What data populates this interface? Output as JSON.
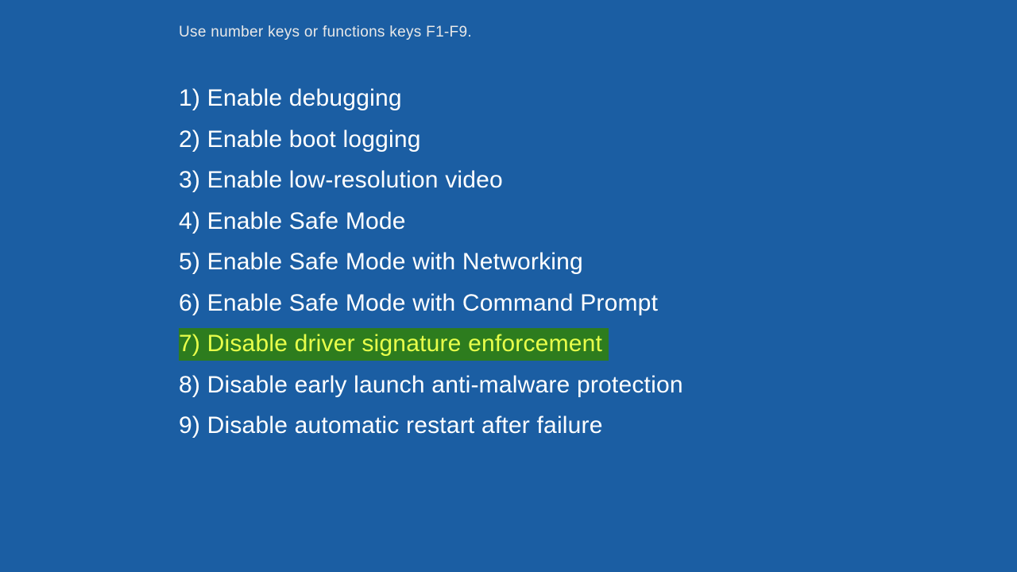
{
  "instruction": "Use number keys or functions keys F1-F9.",
  "options": [
    {
      "key": "1)",
      "label": "Enable debugging",
      "highlighted": false
    },
    {
      "key": "2)",
      "label": "Enable boot logging",
      "highlighted": false
    },
    {
      "key": "3)",
      "label": "Enable low-resolution video",
      "highlighted": false
    },
    {
      "key": "4)",
      "label": "Enable Safe Mode",
      "highlighted": false
    },
    {
      "key": "5)",
      "label": "Enable Safe Mode with Networking",
      "highlighted": false
    },
    {
      "key": "6)",
      "label": "Enable Safe Mode with Command Prompt",
      "highlighted": false
    },
    {
      "key": "7)",
      "label": "Disable driver signature enforcement",
      "highlighted": true
    },
    {
      "key": "8)",
      "label": "Disable early launch anti-malware protection",
      "highlighted": false
    },
    {
      "key": "9)",
      "label": "Disable automatic restart after failure",
      "highlighted": false
    }
  ],
  "colors": {
    "background": "#1b5ea3",
    "highlight_bg": "#2d7c1e",
    "highlight_fg": "#e8ff4a"
  }
}
